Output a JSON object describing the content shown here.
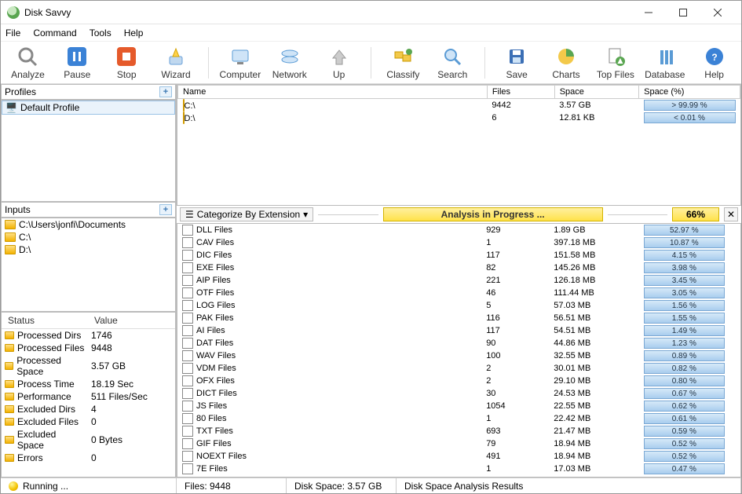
{
  "window": {
    "title": "Disk Savvy"
  },
  "menu": [
    "File",
    "Command",
    "Tools",
    "Help"
  ],
  "toolbar": [
    {
      "label": "Analyze",
      "name": "analyze-button"
    },
    {
      "label": "Pause",
      "name": "pause-button"
    },
    {
      "label": "Stop",
      "name": "stop-button"
    },
    {
      "label": "Wizard",
      "name": "wizard-button"
    },
    {
      "label": "Computer",
      "name": "computer-button"
    },
    {
      "label": "Network",
      "name": "network-button"
    },
    {
      "label": "Up",
      "name": "up-button"
    },
    {
      "label": "Classify",
      "name": "classify-button"
    },
    {
      "label": "Search",
      "name": "search-button"
    },
    {
      "label": "Save",
      "name": "save-button"
    },
    {
      "label": "Charts",
      "name": "charts-button"
    },
    {
      "label": "Top Files",
      "name": "topfiles-button"
    },
    {
      "label": "Database",
      "name": "database-button"
    },
    {
      "label": "Help",
      "name": "help-button"
    }
  ],
  "profiles": {
    "header": "Profiles",
    "items": [
      "Default Profile"
    ]
  },
  "inputs": {
    "header": "Inputs",
    "items": [
      "C:\\Users\\jonfi\\Documents",
      "C:\\",
      "D:\\"
    ]
  },
  "status": {
    "header_status": "Status",
    "header_value": "Value",
    "rows": [
      {
        "label": "Processed Dirs",
        "value": "1746",
        "icon": "folder-icon"
      },
      {
        "label": "Processed Files",
        "value": "9448",
        "icon": "file-icon"
      },
      {
        "label": "Processed Space",
        "value": "3.57 GB",
        "icon": "disk-icon"
      },
      {
        "label": "Process Time",
        "value": "18.19 Sec",
        "icon": "clock-icon"
      },
      {
        "label": "Performance",
        "value": "511 Files/Sec",
        "icon": "gauge-icon"
      },
      {
        "label": "Excluded Dirs",
        "value": "4",
        "icon": "warning-icon"
      },
      {
        "label": "Excluded Files",
        "value": "0",
        "icon": "warning-icon"
      },
      {
        "label": "Excluded Space",
        "value": "0 Bytes",
        "icon": "warning-icon"
      },
      {
        "label": "Errors",
        "value": "0",
        "icon": "error-icon"
      }
    ]
  },
  "drives": {
    "cols": [
      "Name",
      "Files",
      "Space",
      "Space (%)"
    ],
    "rows": [
      {
        "name": "C:\\",
        "files": "9442",
        "space": "3.57 GB",
        "pct": "> 99.99 %"
      },
      {
        "name": "D:\\",
        "files": "6",
        "space": "12.81 KB",
        "pct": "< 0.01 %"
      }
    ]
  },
  "categorize": {
    "label": "Categorize By Extension",
    "progress_msg": "Analysis in Progress ...",
    "progress_pct": "66%"
  },
  "extlist": [
    {
      "name": "DLL Files",
      "files": "929",
      "space": "1.89 GB",
      "pct": "52.97 %"
    },
    {
      "name": "CAV Files",
      "files": "1",
      "space": "397.18 MB",
      "pct": "10.87 %"
    },
    {
      "name": "DIC Files",
      "files": "117",
      "space": "151.58 MB",
      "pct": "4.15 %"
    },
    {
      "name": "EXE Files",
      "files": "82",
      "space": "145.26 MB",
      "pct": "3.98 %"
    },
    {
      "name": "AIP Files",
      "files": "221",
      "space": "126.18 MB",
      "pct": "3.45 %"
    },
    {
      "name": "OTF Files",
      "files": "46",
      "space": "111.44 MB",
      "pct": "3.05 %"
    },
    {
      "name": "LOG Files",
      "files": "5",
      "space": "57.03 MB",
      "pct": "1.56 %"
    },
    {
      "name": "PAK Files",
      "files": "116",
      "space": "56.51 MB",
      "pct": "1.55 %"
    },
    {
      "name": "AI Files",
      "files": "117",
      "space": "54.51 MB",
      "pct": "1.49 %"
    },
    {
      "name": "DAT Files",
      "files": "90",
      "space": "44.86 MB",
      "pct": "1.23 %"
    },
    {
      "name": "WAV Files",
      "files": "100",
      "space": "32.55 MB",
      "pct": "0.89 %"
    },
    {
      "name": "VDM Files",
      "files": "2",
      "space": "30.01 MB",
      "pct": "0.82 %"
    },
    {
      "name": "OFX Files",
      "files": "2",
      "space": "29.10 MB",
      "pct": "0.80 %"
    },
    {
      "name": "DICT Files",
      "files": "30",
      "space": "24.53 MB",
      "pct": "0.67 %"
    },
    {
      "name": "JS Files",
      "files": "1054",
      "space": "22.55 MB",
      "pct": "0.62 %"
    },
    {
      "name": "80 Files",
      "files": "1",
      "space": "22.42 MB",
      "pct": "0.61 %"
    },
    {
      "name": "TXT Files",
      "files": "693",
      "space": "21.47 MB",
      "pct": "0.59 %"
    },
    {
      "name": "GIF Files",
      "files": "79",
      "space": "18.94 MB",
      "pct": "0.52 %"
    },
    {
      "name": "NOEXT Files",
      "files": "491",
      "space": "18.94 MB",
      "pct": "0.52 %"
    },
    {
      "name": "7E Files",
      "files": "1",
      "space": "17.03 MB",
      "pct": "0.47 %"
    }
  ],
  "statusbar": {
    "state": "Running ...",
    "files": "Files: 9448",
    "space": "Disk Space: 3.57 GB",
    "desc": "Disk Space Analysis Results"
  }
}
